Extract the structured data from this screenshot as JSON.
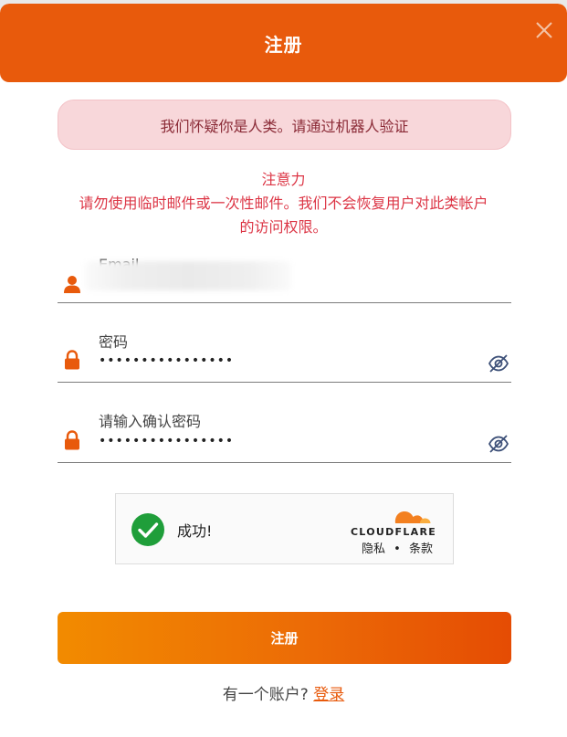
{
  "header": {
    "title": "注册"
  },
  "alert": {
    "text": "我们怀疑你是人类。请通过机器人验证"
  },
  "notice": {
    "title": "注意力",
    "line1": "请勿使用临时邮件或一次性邮件。我们不会恢复用户对此类帐户",
    "line2": "的访问权限。"
  },
  "form": {
    "email_label": "Email",
    "password_label": "密码",
    "password_value": "••••••••••••••••",
    "confirm_label": "请输入确认密码",
    "confirm_value": "••••••••••••••••"
  },
  "captcha": {
    "status": "成功!",
    "brand": "CLOUDFLARE",
    "privacy": "隐私",
    "separator": "•",
    "terms": "条款"
  },
  "submit": {
    "label": "注册"
  },
  "footer": {
    "prompt": "有一个账户?",
    "login_link": "登录"
  },
  "colors": {
    "primary": "#e85a0c",
    "alert_bg": "#f8d7da",
    "alert_text": "#8a2a36",
    "notice_text": "#dc3545",
    "success": "#1f9e3a",
    "cloudflare": "#f38020"
  },
  "icons": {
    "close": "close-icon",
    "email": "user-icon",
    "password": "lock-icon",
    "toggle": "eye-slash-icon",
    "captcha": "check-circle-icon"
  }
}
